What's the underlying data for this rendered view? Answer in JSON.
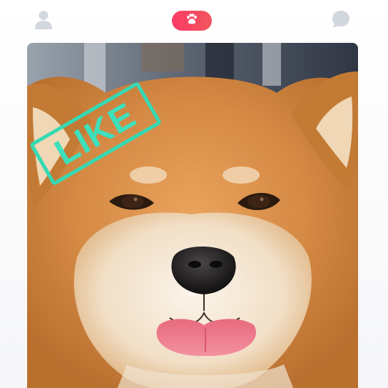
{
  "nav": {
    "profile_icon": "person-icon",
    "center_icon": "paw-icon",
    "chat_icon": "chat-bubble-icon"
  },
  "card": {
    "stamp_label": "LIKE",
    "photo_subject": "shiba-inu-dog-photo"
  },
  "colors": {
    "accent": "#fb3b67",
    "stamp": "#35d9b3",
    "inactive_icon": "#d3d8df"
  }
}
